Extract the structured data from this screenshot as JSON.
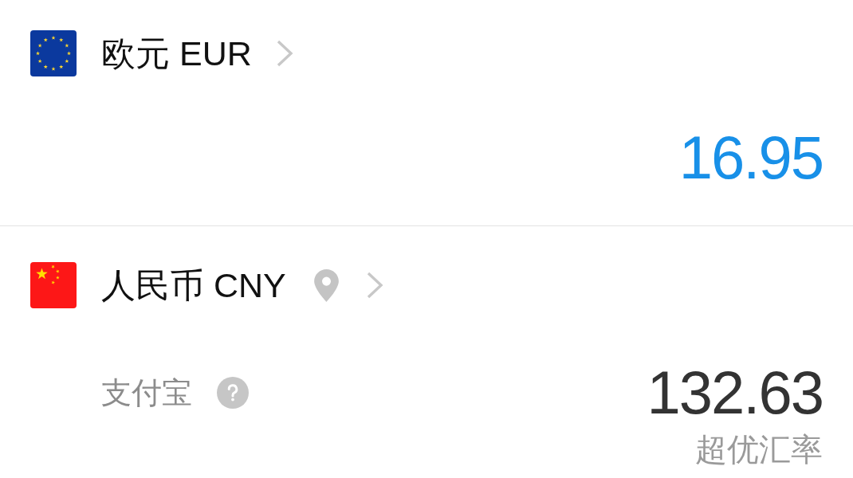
{
  "currencies": [
    {
      "name": "欧元 EUR",
      "is_local": false,
      "active": true,
      "amount": "16.95"
    },
    {
      "name": "人民币 CNY",
      "is_local": true,
      "active": false,
      "provider": "支付宝",
      "amount": "132.63",
      "rate_label": "超优汇率"
    }
  ]
}
